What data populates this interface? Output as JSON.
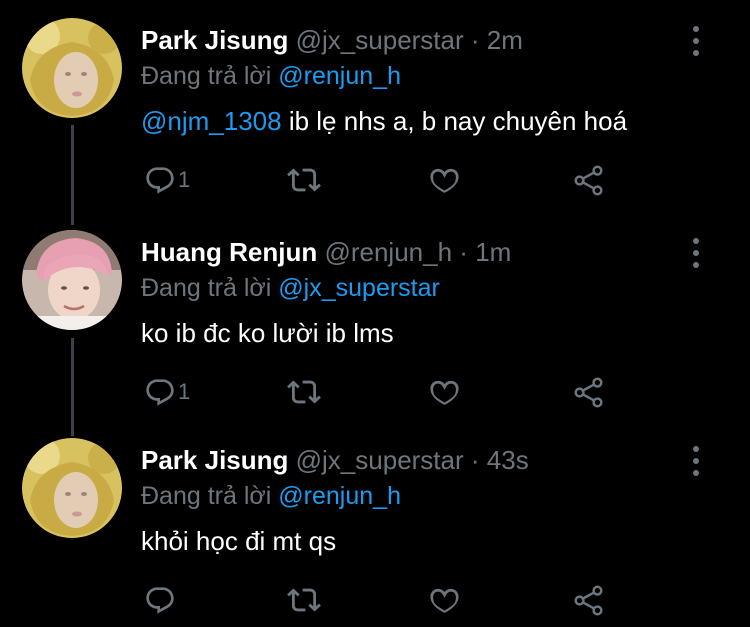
{
  "colors": {
    "background": "#000000",
    "text": "#ffffff",
    "muted": "#6e767d",
    "link": "#1d9bf0",
    "thread_line": "#3d4044"
  },
  "tweets": [
    {
      "author_name": "Park Jisung",
      "handle": "@jx_superstar",
      "separator": "·",
      "time": "2m",
      "replying_prefix": "Đang trả lời",
      "replying_to": "@renjun_h",
      "mention": "@njm_1308",
      "text": " ib lẹ nhs a, b nay chuyên hoá",
      "reply_count": "1",
      "avatar_icon": "avatar-yellow-hood",
      "icons": [
        "more-icon",
        "reply-icon",
        "retweet-icon",
        "like-icon",
        "share-icon"
      ]
    },
    {
      "author_name": "Huang Renjun",
      "handle": "@renjun_h",
      "separator": "·",
      "time": "1m",
      "replying_prefix": "Đang trả lời",
      "replying_to": "@jx_superstar",
      "mention": "",
      "text": "ko ib đc ko lười ib lms",
      "reply_count": "1",
      "avatar_icon": "avatar-pink-hair",
      "icons": [
        "more-icon",
        "reply-icon",
        "retweet-icon",
        "like-icon",
        "share-icon"
      ]
    },
    {
      "author_name": "Park Jisung",
      "handle": "@jx_superstar",
      "separator": "·",
      "time": "43s",
      "replying_prefix": "Đang trả lời",
      "replying_to": "@renjun_h",
      "mention": "",
      "text": "khỏi học đi mt qs",
      "reply_count": "",
      "avatar_icon": "avatar-yellow-hood",
      "icons": [
        "more-icon",
        "reply-icon",
        "retweet-icon",
        "like-icon",
        "share-icon"
      ]
    }
  ]
}
